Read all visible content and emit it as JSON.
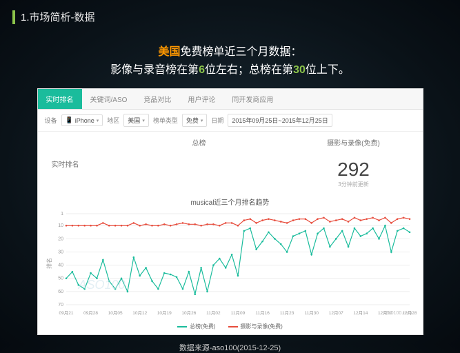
{
  "title": "1.市场简析-数据",
  "headline": {
    "p1a": "美国",
    "p1b": "免费榜单近三个月数据：",
    "p2a": "影像与录音榜在第",
    "p2b": "6",
    "p2c": "位左右；总榜在第",
    "p2d": "30",
    "p2e": "位上下。"
  },
  "tabs": [
    "实时排名",
    "关键词/ASO",
    "竞品对比",
    "用户评论",
    "同开发商应用"
  ],
  "active_tab": 0,
  "filters": {
    "device_lbl": "设备",
    "device_val": "iPhone",
    "region_lbl": "地区",
    "region_val": "美国",
    "type_lbl": "榜单类型",
    "type_val": "免费",
    "date_lbl": "日期",
    "date_val": "2015年09月25日~2015年12月25日"
  },
  "summary": {
    "rowlbl": "实时排名",
    "col1": "总榜",
    "col2": "摄影与录像(免费)",
    "rank": "292",
    "updated": "3分钟前更新"
  },
  "chart_title": "musical近三个月排名趋势",
  "legend": {
    "s1": "总榜(免费)",
    "s2": "摄影与录像(免费)"
  },
  "watermark": "ASO100",
  "corner": "ASO100.com",
  "footer": "数据来源-aso100(2015-12-25)",
  "chart_data": {
    "type": "line",
    "ylabel": "排名",
    "ylim": [
      1,
      70
    ],
    "y_inverted": true,
    "y_ticks": [
      1,
      10,
      20,
      30,
      40,
      50,
      60,
      70
    ],
    "x_ticks": [
      "09月21",
      "09月28",
      "10月05",
      "10月12",
      "10月19",
      "10月26",
      "11月02",
      "11月09",
      "11月16",
      "11月23",
      "11月30",
      "12月07",
      "12月14",
      "12月21",
      "12月28"
    ],
    "series": [
      {
        "name": "总榜(免费)",
        "color": "#1abc9c",
        "values": [
          50,
          45,
          55,
          58,
          46,
          50,
          36,
          52,
          58,
          50,
          60,
          34,
          48,
          42,
          52,
          58,
          46,
          47,
          49,
          58,
          45,
          62,
          42,
          60,
          40,
          35,
          42,
          32,
          48,
          14,
          12,
          28,
          22,
          15,
          20,
          24,
          30,
          18,
          16,
          14,
          32,
          16,
          12,
          26,
          20,
          14,
          26,
          12,
          18,
          16,
          12,
          20,
          10,
          30,
          14,
          12,
          15
        ]
      },
      {
        "name": "摄影与录像(免费)",
        "color": "#e74c3c",
        "values": [
          10,
          10,
          10,
          10,
          10,
          10,
          8,
          10,
          10,
          10,
          10,
          8,
          10,
          9,
          10,
          10,
          9,
          10,
          9,
          8,
          9,
          9,
          10,
          9,
          9,
          10,
          8,
          8,
          10,
          6,
          5,
          8,
          6,
          5,
          6,
          7,
          8,
          6,
          5,
          5,
          8,
          5,
          4,
          7,
          6,
          5,
          7,
          4,
          6,
          5,
          4,
          6,
          4,
          8,
          5,
          4,
          5
        ]
      }
    ]
  }
}
